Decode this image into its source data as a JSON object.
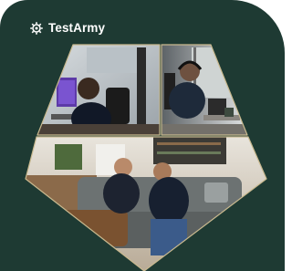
{
  "brand": {
    "name": "TestArmy",
    "logo_icon": "cog-icon"
  },
  "colors": {
    "card_background": "#1e3a33",
    "frame_outline": "#c9b98f",
    "brand_text": "#ffffff"
  },
  "photos": {
    "top_left": "man-at-computer-photo",
    "top_right": "man-with-headphones-photo",
    "bottom": "two-men-on-sofa-photo"
  }
}
